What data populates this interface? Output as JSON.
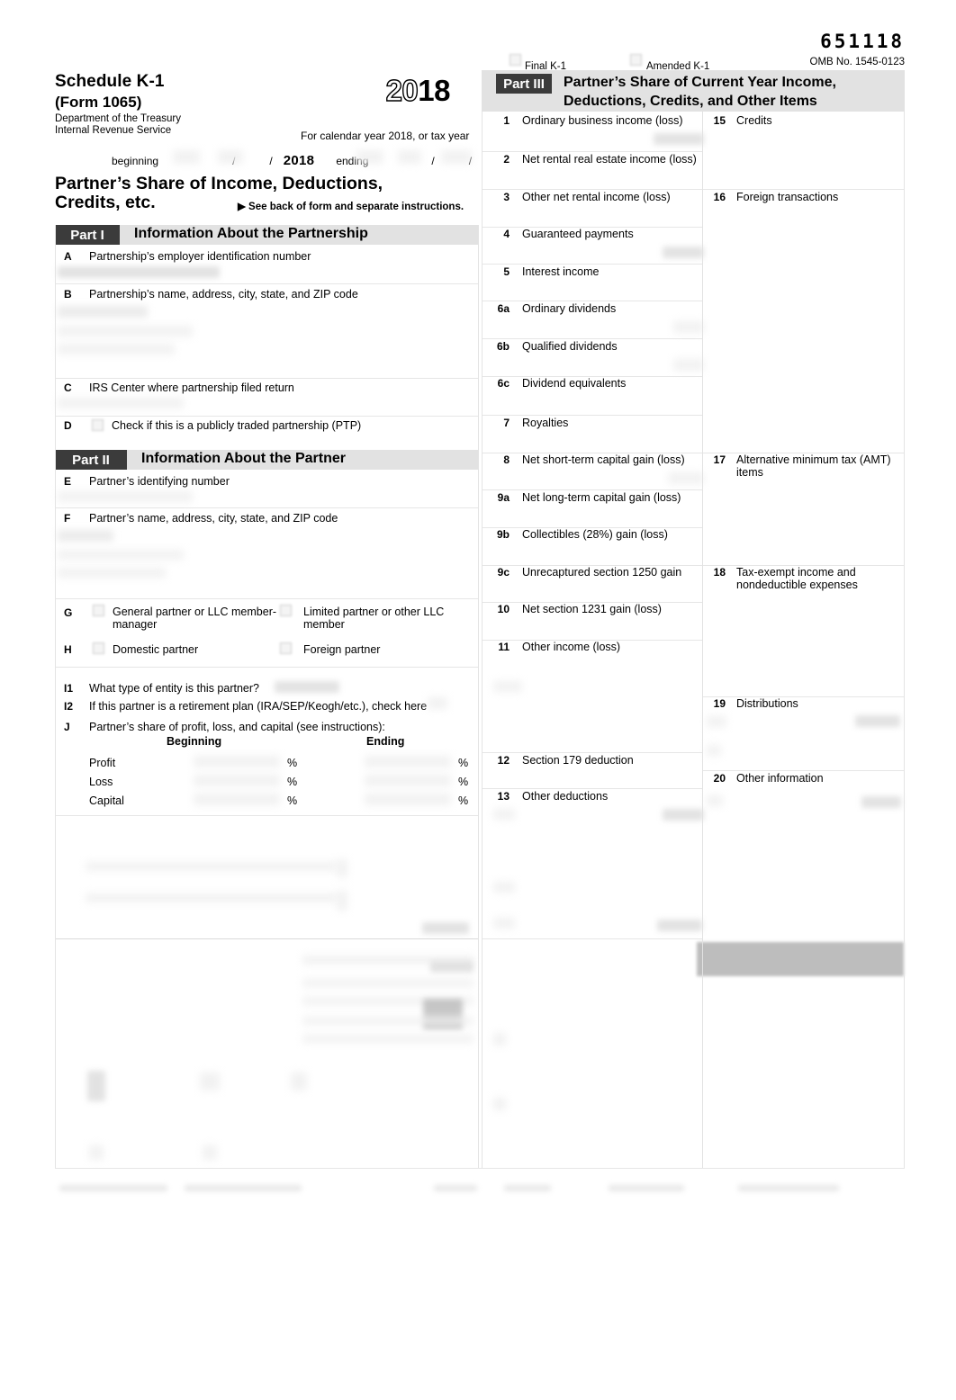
{
  "form": {
    "form_number": "651118",
    "omb": "OMB No. 1545-0123",
    "schedule_title": "Schedule K-1",
    "form_ref": "(Form 1065)",
    "agency_line1": "Department of the Treasury",
    "agency_line2": "Internal Revenue Service",
    "year_prefix": "20",
    "year_suffix": "18",
    "calendar_line": "For calendar year 2018, or tax year",
    "beginning_label": "beginning",
    "ending_label": "ending",
    "date_slash": "/",
    "tax_year": "2018",
    "main_title_line1": "Partner’s Share of Income, Deductions,",
    "main_title_line2": "Credits, etc.",
    "see_back": "▶ See back of form and separate instructions."
  },
  "top_checkboxes": [
    {
      "label": "Final K-1"
    },
    {
      "label": "Amended K-1"
    }
  ],
  "part1": {
    "chip": "Part I",
    "title": "Information About the Partnership",
    "fields": [
      {
        "letter": "A",
        "label": "Partnership’s employer identification number"
      },
      {
        "letter": "B",
        "label": "Partnership’s name, address, city, state, and ZIP code"
      },
      {
        "letter": "C",
        "label": "IRS Center where partnership filed return"
      },
      {
        "letter": "D",
        "label": "Check if this is a publicly traded partnership (PTP)"
      }
    ]
  },
  "part2": {
    "chip": "Part II",
    "title": "Information About the Partner",
    "fields": [
      {
        "letter": "E",
        "label": "Partner’s identifying number"
      },
      {
        "letter": "F",
        "label": "Partner’s name, address, city, state, and ZIP code"
      }
    ],
    "g_left": "General partner or LLC member-manager",
    "g_right": "Limited partner or other LLC member",
    "h_left": "Domestic partner",
    "h_right": "Foreign partner",
    "g_letter": "G",
    "h_letter": "H",
    "i1_letter": "I1",
    "i1_label": "What type of entity is this partner?",
    "i2_letter": "I2",
    "i2_label": "If this partner is a retirement plan (IRA/SEP/Keogh/etc.), check here",
    "j_letter": "J",
    "j_label": "Partner’s share of profit, loss, and capital (see instructions):",
    "j_col_beginning": "Beginning",
    "j_col_ending": "Ending",
    "j_rows": [
      "Profit",
      "Loss",
      "Capital"
    ],
    "percent_symbol": "%"
  },
  "part3": {
    "chip": "Part III",
    "title_line1": "Partner’s Share of Current Year Income,",
    "title_line2": "Deductions, Credits, and Other Items",
    "left_items": [
      {
        "num": "1",
        "label": "Ordinary business income (loss)"
      },
      {
        "num": "2",
        "label": "Net rental real estate income (loss)"
      },
      {
        "num": "3",
        "label": "Other net rental income (loss)"
      },
      {
        "num": "4",
        "label": "Guaranteed payments"
      },
      {
        "num": "5",
        "label": "Interest income"
      },
      {
        "num": "6a",
        "label": "Ordinary dividends"
      },
      {
        "num": "6b",
        "label": "Qualified dividends"
      },
      {
        "num": "6c",
        "label": "Dividend equivalents"
      },
      {
        "num": "7",
        "label": "Royalties"
      },
      {
        "num": "8",
        "label": "Net short-term capital gain (loss)"
      },
      {
        "num": "9a",
        "label": "Net long-term capital gain (loss)"
      },
      {
        "num": "9b",
        "label": "Collectibles (28%) gain (loss)"
      },
      {
        "num": "9c",
        "label": "Unrecaptured section 1250 gain"
      },
      {
        "num": "10",
        "label": "Net section 1231 gain (loss)"
      },
      {
        "num": "11",
        "label": "Other income (loss)"
      },
      {
        "num": "12",
        "label": "Section 179 deduction"
      },
      {
        "num": "13",
        "label": "Other deductions"
      }
    ],
    "right_items": [
      {
        "num": "15",
        "label": "Credits"
      },
      {
        "num": "16",
        "label": "Foreign transactions"
      },
      {
        "num": "17",
        "label": "Alternative minimum tax (AMT) items"
      },
      {
        "num": "18",
        "label": "Tax-exempt income and nondeductible expenses"
      },
      {
        "num": "19",
        "label": "Distributions"
      },
      {
        "num": "20",
        "label": "Other information"
      }
    ]
  },
  "colors": {
    "chip_bg": "#3b3b3b",
    "shade_bg": "#e2e2e2",
    "irs_block": "#bdbdbd",
    "rule": "#e6e6e6"
  }
}
